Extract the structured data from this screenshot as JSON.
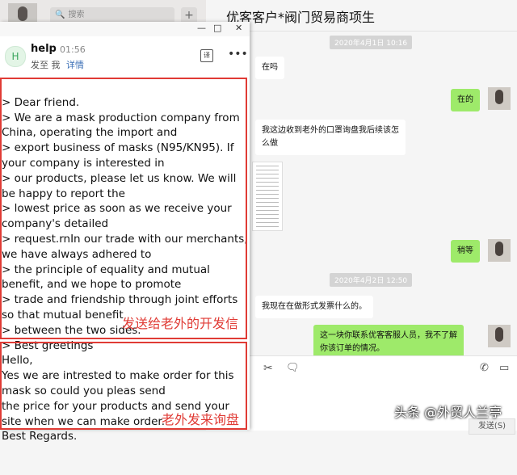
{
  "chat_window": {
    "search_placeholder": "搜索",
    "title": "优客客户*阀门贸易商项生",
    "timestamps": [
      "2020年4月1日 10:16",
      "2020年4月2日 12:50"
    ],
    "messages": [
      {
        "side": "left",
        "text": "在吗"
      },
      {
        "side": "right",
        "text": "在的"
      },
      {
        "side": "left",
        "text": "我这边收到老外的口罩询盘我后续该怎\n么做"
      },
      {
        "side": "left",
        "kind": "document-thumbnail"
      },
      {
        "side": "right",
        "text": "稍等"
      },
      {
        "side": "left",
        "text": "我现在在做形式发票什么的。"
      },
      {
        "side": "right",
        "text": "这一块你联系优客客服人员，我不了解\n你该订单的情况。"
      }
    ],
    "send_button": "发送(S)"
  },
  "mail_window": {
    "controls": {
      "minimize": "—",
      "maximize": "□",
      "close": "✕"
    },
    "sender": {
      "avatar_letter": "H",
      "name": "help",
      "time": "01:56",
      "to": "发至 我",
      "detail_link": "详情"
    },
    "body_lines": [
      "> Dear friend.",
      "> We are a mask production company from",
      "China, operating the import and",
      "> export business of masks (N95/KN95). If",
      "your company is interested in",
      "> our products, please let us know. We will",
      "be happy to report the",
      "> lowest price as soon as we receive your",
      "company's detailed",
      "> request.rnIn our trade with our merchants,",
      "we have always adhered to",
      "> the principle of equality and mutual",
      "benefit, and we hope to promote",
      "> trade and friendship through joint efforts",
      "so that mutual benefit",
      "> between the two sides.",
      "> Best greetings",
      "Hello,",
      "Yes we are intrested to make order for this",
      "mask so could you pleas send",
      "the price for your products and send your",
      "site when we can make order.",
      "Best Regards."
    ]
  },
  "annotations": {
    "box1_label": "发送给老外的开发信",
    "box2_label": "老外发来询盘"
  },
  "watermark": "头条 @外贸人兰亭",
  "colors": {
    "highlight_red": "#e03b35",
    "wechat_green": "#9eea6a",
    "link_blue": "#3b6fb6"
  },
  "icons": [
    "search-icon",
    "plus-icon",
    "scissors-icon",
    "chat-history-icon",
    "phone-icon",
    "video-icon",
    "translate-icon",
    "more-icon"
  ]
}
